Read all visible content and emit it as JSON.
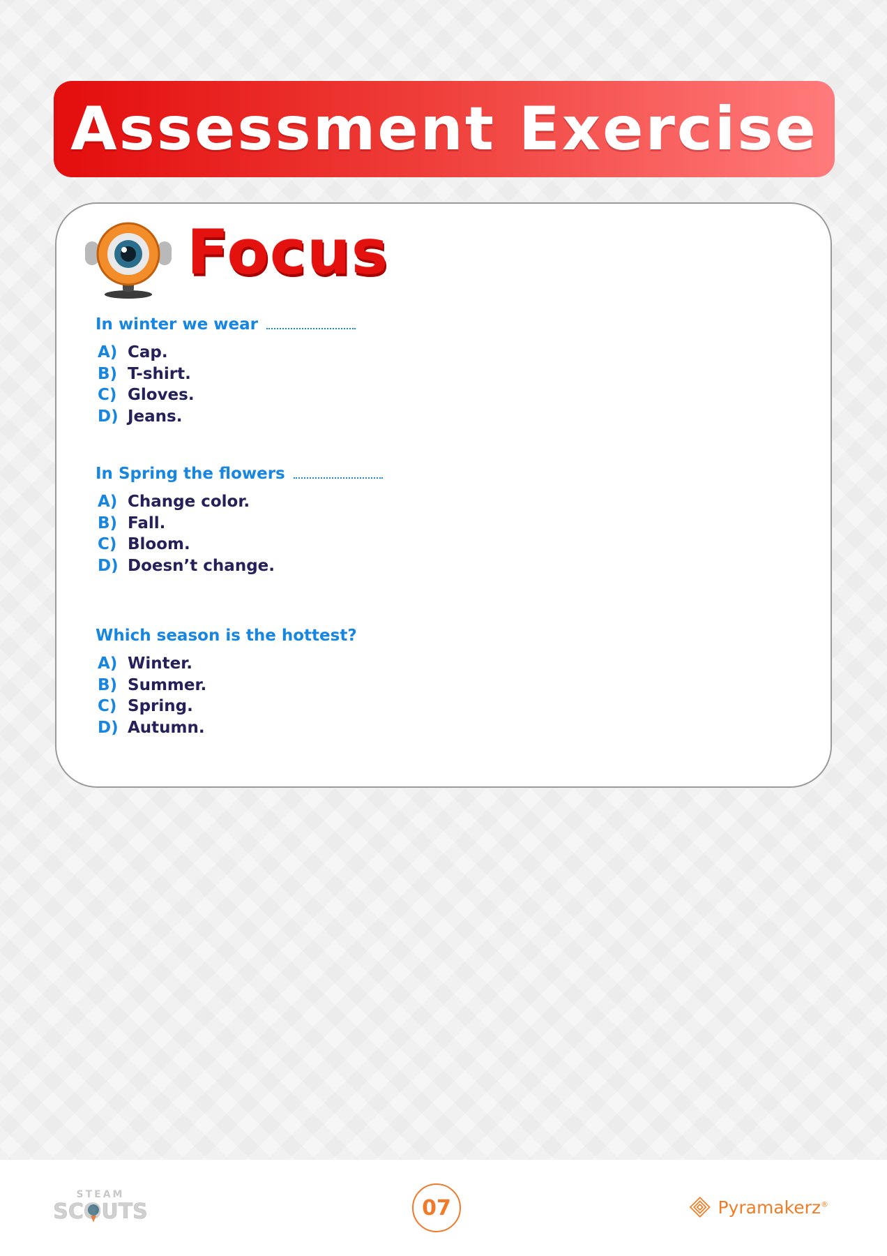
{
  "header": {
    "title": "Assessment Exercise"
  },
  "section": {
    "title": "Focus"
  },
  "questions": [
    {
      "text": "In winter we wear",
      "blank": true,
      "options": [
        {
          "letter": "A)",
          "text": "Cap."
        },
        {
          "letter": "B)",
          "text": "T-shirt."
        },
        {
          "letter": "C)",
          "text": "Gloves."
        },
        {
          "letter": "D)",
          "text": "Jeans."
        }
      ]
    },
    {
      "text": "In Spring the flowers",
      "blank": true,
      "options": [
        {
          "letter": "A)",
          "text": "Change color."
        },
        {
          "letter": "B)",
          "text": "Fall."
        },
        {
          "letter": "C)",
          "text": "Bloom."
        },
        {
          "letter": "D)",
          "text": "Doesn’t change."
        }
      ]
    },
    {
      "text": "Which season is the hottest?",
      "blank": false,
      "options": [
        {
          "letter": "A)",
          "text": "Winter."
        },
        {
          "letter": "B)",
          "text": "Summer."
        },
        {
          "letter": "C)",
          "text": "Spring."
        },
        {
          "letter": "D)",
          "text": "Autumn."
        }
      ]
    }
  ],
  "footer": {
    "left_logo_top": "STEAM",
    "left_logo_bottom": "SCOUTS",
    "page_number": "07",
    "right_logo_name": "Pyramakerz",
    "right_logo_mark": "®"
  },
  "colors": {
    "banner_start": "#e30d0d",
    "banner_end": "#ff7b7b",
    "question_blue": "#1786e0",
    "option_navy": "#24215a",
    "focus_red": "#e3120f",
    "footer_orange": "#ef7d25"
  },
  "icons": {
    "mascot": "robot-eye-mascot-icon",
    "scouts": "steam-scouts-logo-icon",
    "pyramakerz": "pyramakerz-diamond-icon"
  }
}
